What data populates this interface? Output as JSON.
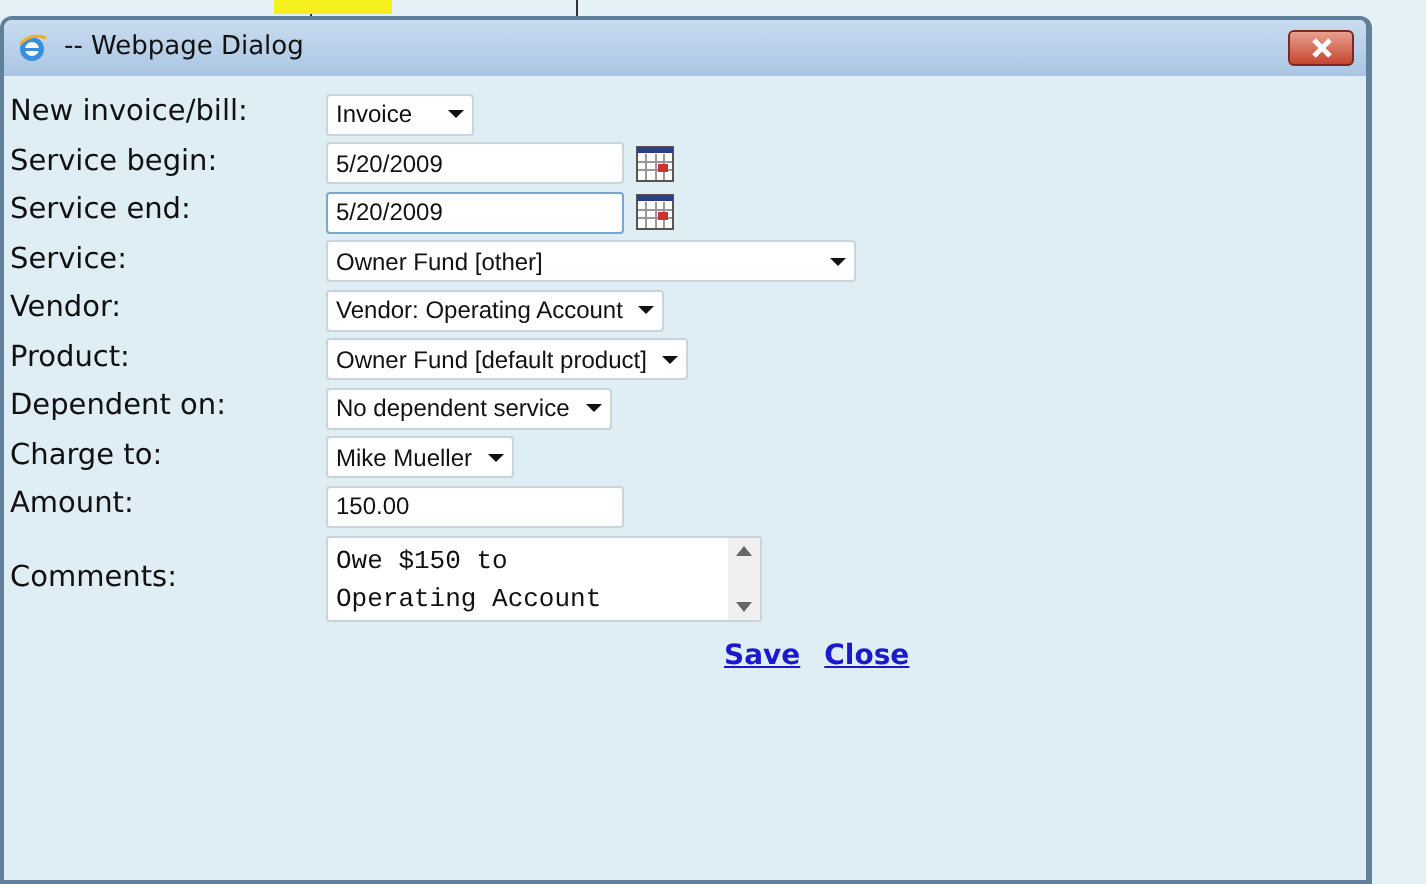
{
  "window": {
    "title": "-- Webpage Dialog"
  },
  "fields": [
    {
      "label": "New invoice/bill:",
      "kind": "select",
      "value": "Invoice"
    },
    {
      "label": "Service begin:",
      "kind": "date",
      "value": "5/20/2009",
      "focused": false
    },
    {
      "label": "Service end:",
      "kind": "date",
      "value": "5/20/2009",
      "focused": true
    },
    {
      "label": "Service:",
      "kind": "select",
      "value": "Owner Fund [other]"
    },
    {
      "label": "Vendor:",
      "kind": "select",
      "value": "Vendor: Operating Account"
    },
    {
      "label": "Product:",
      "kind": "select",
      "value": "Owner Fund [default product]"
    },
    {
      "label": "Dependent on:",
      "kind": "select",
      "value": "No dependent service"
    },
    {
      "label": "Charge to:",
      "kind": "select",
      "value": "Mike Mueller"
    },
    {
      "label": "Amount:",
      "kind": "text",
      "value": "150.00"
    },
    {
      "label": "Comments:",
      "kind": "textarea",
      "value": "Owe $150 to\nOperating Account"
    }
  ],
  "links": [
    "Save",
    "Close"
  ]
}
